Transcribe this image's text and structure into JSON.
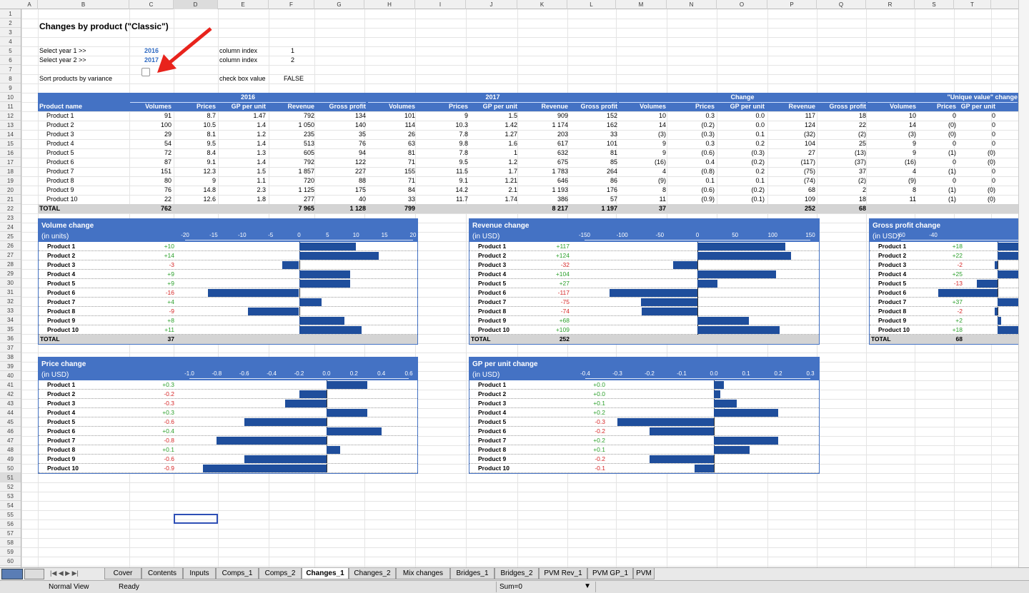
{
  "columns": [
    "A",
    "B",
    "C",
    "D",
    "E",
    "F",
    "G",
    "H",
    "I",
    "J",
    "K",
    "L",
    "M",
    "N",
    "O",
    "P",
    "Q",
    "R",
    "S",
    "T"
  ],
  "title": "Changes by product (\"Classic\")",
  "controls": {
    "year1_label": "Select year 1 >>",
    "year1_value": "2016",
    "year2_label": "Select year 2 >>",
    "year2_value": "2017",
    "sort_label": "Sort products by variance",
    "colidx_label1": "column index",
    "colidx_value1": "1",
    "colidx_label2": "column index",
    "colidx_value2": "2",
    "checkbox_label": "check box value",
    "checkbox_value": "FALSE"
  },
  "table": {
    "group_headers": [
      "2016",
      "2017",
      "Change",
      "\"Unique value\" change"
    ],
    "headers": [
      "Product name",
      "Volumes",
      "Prices",
      "GP per unit",
      "Revenue",
      "Gross profit",
      "Volumes",
      "Prices",
      "GP per unit",
      "Revenue",
      "Gross profit",
      "Volumes",
      "Prices",
      "GP per unit",
      "Revenue",
      "Gross profit",
      "Volumes",
      "Prices",
      "GP per unit"
    ],
    "rows": [
      [
        "Product 1",
        "91",
        "8.7",
        "1.47",
        "792",
        "134",
        "101",
        "9",
        "1.5",
        "909",
        "152",
        "10",
        "0.3",
        "0.0",
        "117",
        "18",
        "10",
        "0",
        "0"
      ],
      [
        "Product 2",
        "100",
        "10.5",
        "1.4",
        "1 050",
        "140",
        "114",
        "10.3",
        "1.42",
        "1 174",
        "162",
        "14",
        "(0.2)",
        "0.0",
        "124",
        "22",
        "14",
        "(0)",
        "0"
      ],
      [
        "Product 3",
        "29",
        "8.1",
        "1.2",
        "235",
        "35",
        "26",
        "7.8",
        "1.27",
        "203",
        "33",
        "(3)",
        "(0.3)",
        "0.1",
        "(32)",
        "(2)",
        "(3)",
        "(0)",
        "0"
      ],
      [
        "Product 4",
        "54",
        "9.5",
        "1.4",
        "513",
        "76",
        "63",
        "9.8",
        "1.6",
        "617",
        "101",
        "9",
        "0.3",
        "0.2",
        "104",
        "25",
        "9",
        "0",
        "0"
      ],
      [
        "Product 5",
        "72",
        "8.4",
        "1.3",
        "605",
        "94",
        "81",
        "7.8",
        "1",
        "632",
        "81",
        "9",
        "(0.6)",
        "(0.3)",
        "27",
        "(13)",
        "9",
        "(1)",
        "(0)"
      ],
      [
        "Product 6",
        "87",
        "9.1",
        "1.4",
        "792",
        "122",
        "71",
        "9.5",
        "1.2",
        "675",
        "85",
        "(16)",
        "0.4",
        "(0.2)",
        "(117)",
        "(37)",
        "(16)",
        "0",
        "(0)"
      ],
      [
        "Product 7",
        "151",
        "12.3",
        "1.5",
        "1 857",
        "227",
        "155",
        "11.5",
        "1.7",
        "1 783",
        "264",
        "4",
        "(0.8)",
        "0.2",
        "(75)",
        "37",
        "4",
        "(1)",
        "0"
      ],
      [
        "Product 8",
        "80",
        "9",
        "1.1",
        "720",
        "88",
        "71",
        "9.1",
        "1.21",
        "646",
        "86",
        "(9)",
        "0.1",
        "0.1",
        "(74)",
        "(2)",
        "(9)",
        "0",
        "0"
      ],
      [
        "Product 9",
        "76",
        "14.8",
        "2.3",
        "1 125",
        "175",
        "84",
        "14.2",
        "2.1",
        "1 193",
        "176",
        "8",
        "(0.6)",
        "(0.2)",
        "68",
        "2",
        "8",
        "(1)",
        "(0)"
      ],
      [
        "Product 10",
        "22",
        "12.6",
        "1.8",
        "277",
        "40",
        "33",
        "11.7",
        "1.74",
        "386",
        "57",
        "11",
        "(0.9)",
        "(0.1)",
        "109",
        "18",
        "11",
        "(1)",
        "(0)"
      ]
    ],
    "total": [
      "TOTAL",
      "762",
      "",
      "",
      "7 965",
      "1 128",
      "799",
      "",
      "",
      "8 217",
      "1 197",
      "37",
      "",
      "",
      "252",
      "68",
      "",
      "",
      ""
    ]
  },
  "charts": [
    {
      "id": "volume",
      "title": "Volume change",
      "unit": "(in units)",
      "ticks": [
        "-20",
        "-15",
        "-10",
        "-5",
        "0",
        "5",
        "10",
        "15",
        "20"
      ],
      "tick_values": [
        -20,
        -15,
        -10,
        -5,
        0,
        5,
        10,
        15,
        20
      ],
      "min": -20,
      "max": 20,
      "labels": [
        "+10",
        "+14",
        "-3",
        "+9",
        "+9",
        "-16",
        "+4",
        "-9",
        "+8",
        "+11"
      ],
      "values": [
        10,
        14,
        -3,
        9,
        9,
        -16,
        4,
        -9,
        8,
        11
      ],
      "total_label": "TOTAL",
      "total": "37"
    },
    {
      "id": "revenue",
      "title": "Revenue change",
      "unit": "(in USD)",
      "ticks": [
        "-150",
        "-100",
        "-50",
        "0",
        "50",
        "100",
        "150"
      ],
      "tick_values": [
        -150,
        -100,
        -50,
        0,
        50,
        100,
        150
      ],
      "min": -150,
      "max": 150,
      "labels": [
        "+117",
        "+124",
        "-32",
        "+104",
        "+27",
        "-117",
        "-75",
        "-74",
        "+68",
        "+109"
      ],
      "values": [
        117,
        124,
        -32,
        104,
        27,
        -117,
        -75,
        -74,
        68,
        109
      ],
      "total_label": "TOTAL",
      "total": "252"
    },
    {
      "id": "gp",
      "title": "Gross profit change",
      "unit": "(in USD)",
      "ticks": [
        "-60",
        "-40"
      ],
      "tick_values": [
        -60,
        -40
      ],
      "min": -60,
      "max": 60,
      "labels": [
        "+18",
        "+22",
        "-2",
        "+25",
        "-13",
        "-37",
        "+37",
        "-2",
        "+2",
        "+18"
      ],
      "values": [
        18,
        22,
        -2,
        25,
        -13,
        -37,
        37,
        -2,
        2,
        18
      ],
      "total_label": "TOTAL",
      "total": "68"
    },
    {
      "id": "price",
      "title": "Price change",
      "unit": "(in USD)",
      "ticks": [
        "-1.0",
        "-0.8",
        "-0.6",
        "-0.4",
        "-0.2",
        "0.0",
        "0.2",
        "0.4",
        "0.6"
      ],
      "tick_values": [
        -1.0,
        -0.8,
        -0.6,
        -0.4,
        -0.2,
        0,
        0.2,
        0.4,
        0.6
      ],
      "min": -1.0,
      "max": 0.6,
      "labels": [
        "+0.3",
        "-0.2",
        "-0.3",
        "+0.3",
        "-0.6",
        "+0.4",
        "-0.8",
        "+0.1",
        "-0.6",
        "-0.9"
      ],
      "values": [
        0.3,
        -0.2,
        -0.3,
        0.3,
        -0.6,
        0.4,
        -0.8,
        0.1,
        -0.6,
        -0.9
      ]
    },
    {
      "id": "gpunit",
      "title": "GP per unit change",
      "unit": "(in USD)",
      "ticks": [
        "-0.4",
        "-0.3",
        "-0.2",
        "-0.1",
        "0.0",
        "0.1",
        "0.2",
        "0.3"
      ],
      "tick_values": [
        -0.4,
        -0.3,
        -0.2,
        -0.1,
        0,
        0.1,
        0.2,
        0.3
      ],
      "min": -0.4,
      "max": 0.3,
      "labels": [
        "+0.0",
        "+0.0",
        "+0.1",
        "+0.2",
        "-0.3",
        "-0.2",
        "+0.2",
        "+0.1",
        "-0.2",
        "-0.1"
      ],
      "values": [
        0.03,
        0.02,
        0.07,
        0.2,
        -0.3,
        -0.2,
        0.2,
        0.11,
        -0.2,
        -0.06
      ]
    }
  ],
  "products": [
    "Product 1",
    "Product 2",
    "Product 3",
    "Product 4",
    "Product 5",
    "Product 6",
    "Product 7",
    "Product 8",
    "Product 9",
    "Product 10"
  ],
  "tabs": [
    "Cover",
    "Contents",
    "Inputs",
    "Comps_1",
    "Comps_2",
    "Changes_1",
    "Changes_2",
    "Mix changes",
    "Bridges_1",
    "Bridges_2",
    "PVM Rev_1",
    "PVM GP_1",
    "PVM"
  ],
  "active_tab": "Changes_1",
  "status": {
    "view": "Normal View",
    "ready": "Ready",
    "sum": "Sum=0"
  },
  "colors": {
    "accent": "#4472c4",
    "bar": "#1f4e9c",
    "positive": "#2ca02c",
    "negative": "#d62728",
    "arrow": "#e8231c"
  }
}
